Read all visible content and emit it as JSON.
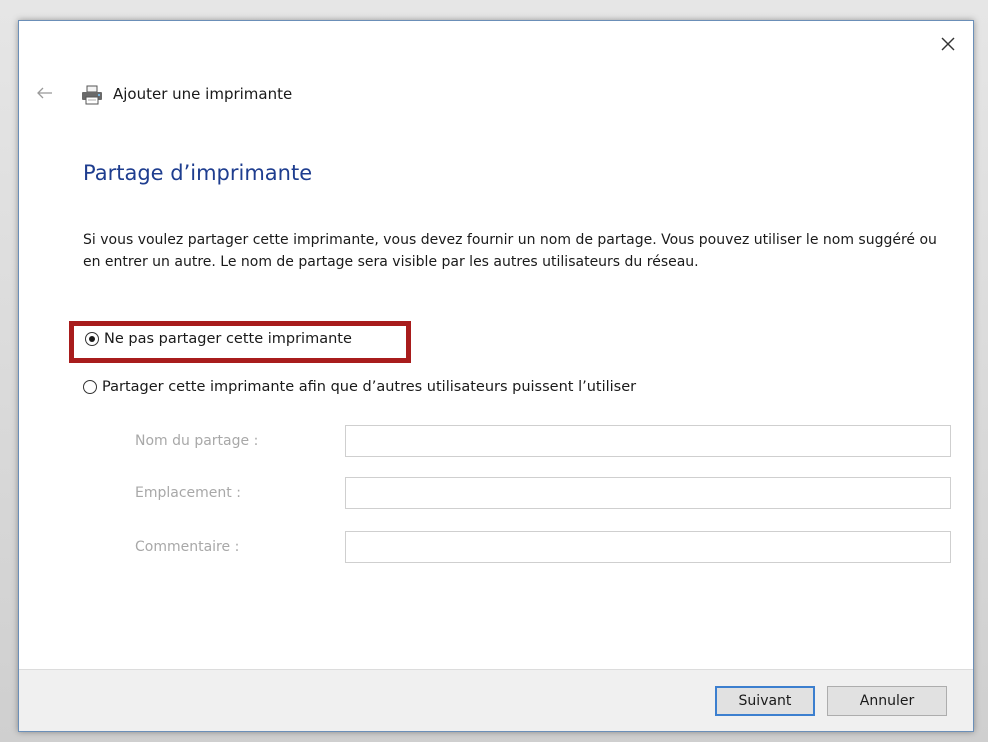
{
  "window": {
    "title": "Ajouter une imprimante",
    "close_icon": "close-icon",
    "back_icon": "back-arrow-icon",
    "title_icon": "printer-icon"
  },
  "page": {
    "heading": "Partage d’imprimante",
    "description": "Si vous voulez partager cette imprimante, vous devez fournir un nom de partage. Vous pouvez utiliser le nom suggéré ou en entrer un autre. Le nom de partage sera visible par les autres utilisateurs du réseau."
  },
  "options": {
    "no_share": {
      "label": "Ne pas partager cette imprimante",
      "selected": true
    },
    "share": {
      "label": "Partager cette imprimante afin que d’autres utilisateurs puissent l’utiliser",
      "selected": false
    }
  },
  "fields": {
    "share_name": {
      "label": "Nom du partage :",
      "value": ""
    },
    "location": {
      "label": "Emplacement :",
      "value": ""
    },
    "comment": {
      "label": "Commentaire :",
      "value": ""
    }
  },
  "buttons": {
    "next": "Suivant",
    "cancel": "Annuler"
  },
  "colors": {
    "heading": "#1e3d8f",
    "highlight": "#a81c1c",
    "primary_border": "#3c7fcf"
  }
}
